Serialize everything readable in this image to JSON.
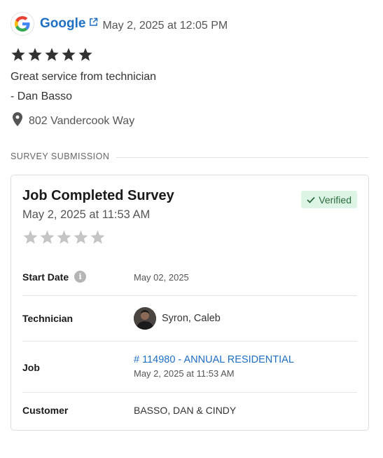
{
  "review": {
    "source": "Google",
    "source_icon": "google-g-logo",
    "link_icon": "external-link-icon",
    "date": "May 2, 2025 at 12:05 PM",
    "rating": 5,
    "text": "Great service from technician",
    "author": "- Dan Basso",
    "location": "802 Vandercook Way"
  },
  "section": {
    "label": "SURVEY SUBMISSION"
  },
  "survey": {
    "title": "Job Completed Survey",
    "date": "May 2, 2025 at 11:53 AM",
    "badge": "Verified",
    "rating": 0,
    "rows": {
      "start_date": {
        "label": "Start Date",
        "value": "May 02, 2025"
      },
      "technician": {
        "label": "Technician",
        "value": "Syron, Caleb"
      },
      "job": {
        "label": "Job",
        "link": "# 114980 - ANNUAL RESIDENTIAL",
        "date": "May 2, 2025 at 11:53 AM"
      },
      "customer": {
        "label": "Customer",
        "value": "BASSO, DAN & CINDY"
      }
    }
  },
  "colors": {
    "link": "#1f6fc5",
    "star_filled": "#333333",
    "star_empty": "#c4c4c4",
    "verified_bg": "#dcf5e4",
    "verified_text": "#2c6b3d"
  }
}
